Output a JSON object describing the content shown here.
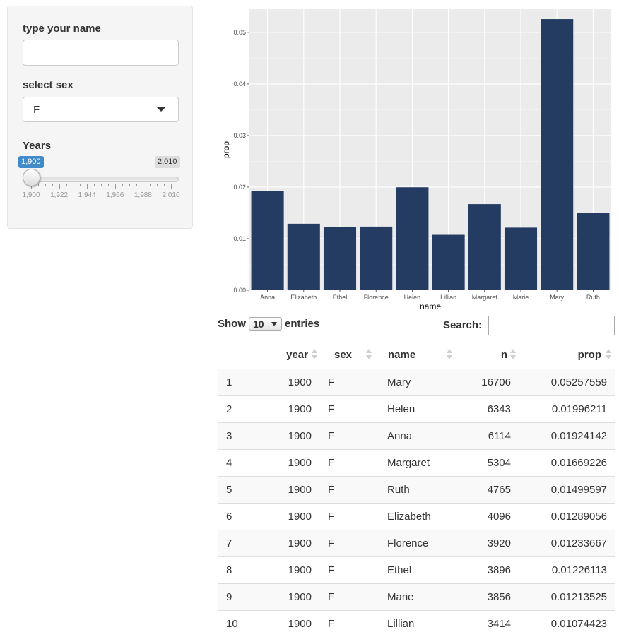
{
  "sidebar": {
    "name_label": "type your name",
    "name_value": "",
    "sex_label": "select sex",
    "sex_value": "F",
    "years_label": "Years",
    "slider": {
      "from_label": "1,900",
      "to_label": "2,010",
      "min": 1900,
      "max": 2010,
      "from": 1900,
      "to": 1900,
      "grid_labels": [
        "1,900",
        "1,922",
        "1,944",
        "1,966",
        "1,988",
        "2,010"
      ]
    }
  },
  "chart_data": {
    "type": "bar",
    "categories": [
      "Anna",
      "Elizabeth",
      "Ethel",
      "Florence",
      "Helen",
      "Lillian",
      "Margaret",
      "Marie",
      "Mary",
      "Ruth"
    ],
    "values": [
      0.01924142,
      0.01289056,
      0.01226113,
      0.01233667,
      0.01996211,
      0.01074423,
      0.01669226,
      0.01213525,
      0.05257559,
      0.01499597
    ],
    "title": "",
    "xlabel": "name",
    "ylabel": "prop",
    "ylim": [
      0,
      0.0545
    ],
    "y_ticks": [
      0.0,
      0.01,
      0.02,
      0.03,
      0.04,
      0.05
    ],
    "y_tick_labels": [
      "0.00",
      "0.01",
      "0.02",
      "0.03",
      "0.04",
      "0.05"
    ],
    "grid": true,
    "bar_color": "#253c62",
    "panel_color": "#ebebeb"
  },
  "table_controls": {
    "show_label": "Show",
    "length_value": "10",
    "entries_label": "entries",
    "search_label": "Search:",
    "search_value": ""
  },
  "table": {
    "columns": [
      "",
      "year",
      "sex",
      "name",
      "n",
      "prop"
    ],
    "rows": [
      [
        "1",
        "1900",
        "F",
        "Mary",
        "16706",
        "0.05257559"
      ],
      [
        "2",
        "1900",
        "F",
        "Helen",
        "6343",
        "0.01996211"
      ],
      [
        "3",
        "1900",
        "F",
        "Anna",
        "6114",
        "0.01924142"
      ],
      [
        "4",
        "1900",
        "F",
        "Margaret",
        "5304",
        "0.01669226"
      ],
      [
        "5",
        "1900",
        "F",
        "Ruth",
        "4765",
        "0.01499597"
      ],
      [
        "6",
        "1900",
        "F",
        "Elizabeth",
        "4096",
        "0.01289056"
      ],
      [
        "7",
        "1900",
        "F",
        "Florence",
        "3920",
        "0.01233667"
      ],
      [
        "8",
        "1900",
        "F",
        "Ethel",
        "3896",
        "0.01226113"
      ],
      [
        "9",
        "1900",
        "F",
        "Marie",
        "3856",
        "0.01213525"
      ],
      [
        "10",
        "1900",
        "F",
        "Lillian",
        "3414",
        "0.01074423"
      ]
    ]
  }
}
